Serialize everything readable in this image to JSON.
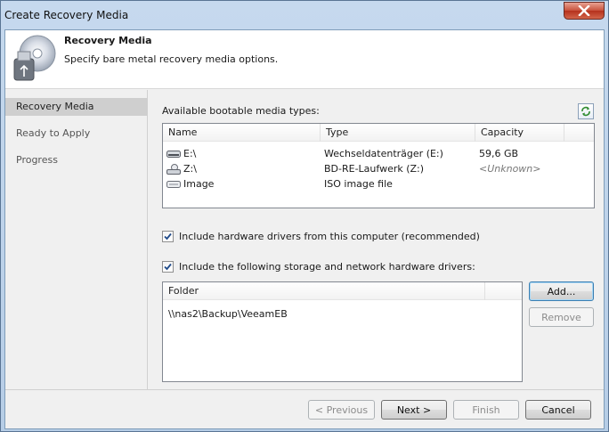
{
  "window": {
    "title": "Create Recovery Media"
  },
  "header": {
    "title": "Recovery Media",
    "subtitle": "Specify bare metal recovery media options."
  },
  "steps": [
    {
      "label": "Recovery Media",
      "active": true
    },
    {
      "label": "Ready to Apply",
      "active": false
    },
    {
      "label": "Progress",
      "active": false
    }
  ],
  "media": {
    "label": "Available bootable media types:",
    "columns": [
      "Name",
      "Type",
      "Capacity"
    ],
    "rows": [
      {
        "name": "E:\\",
        "type": "Wechseldatenträger (E:)",
        "capacity": "59,6 GB",
        "icon": "removable-drive-icon"
      },
      {
        "name": "Z:\\",
        "type": "BD-RE-Laufwerk (Z:)",
        "capacity": "<Unknown>",
        "icon": "optical-drive-icon"
      },
      {
        "name": "Image",
        "type": "ISO image file",
        "capacity": "",
        "icon": "image-drive-icon"
      }
    ]
  },
  "options": {
    "include_hw_drivers": {
      "label": "Include hardware drivers from this computer (recommended)",
      "checked": true
    },
    "include_storage_drivers": {
      "label": "Include the following storage and network hardware drivers:",
      "checked": true
    }
  },
  "folders": {
    "column": "Folder",
    "rows": [
      "\\\\nas2\\Backup\\VeeamEB"
    ]
  },
  "buttons": {
    "add": "Add...",
    "remove": "Remove",
    "previous": "< Previous",
    "next": "Next >",
    "finish": "Finish",
    "cancel": "Cancel"
  },
  "colors": {
    "accent": "#3c7fb1",
    "close": "#c8503a",
    "active_step": "#cfcfcf"
  }
}
